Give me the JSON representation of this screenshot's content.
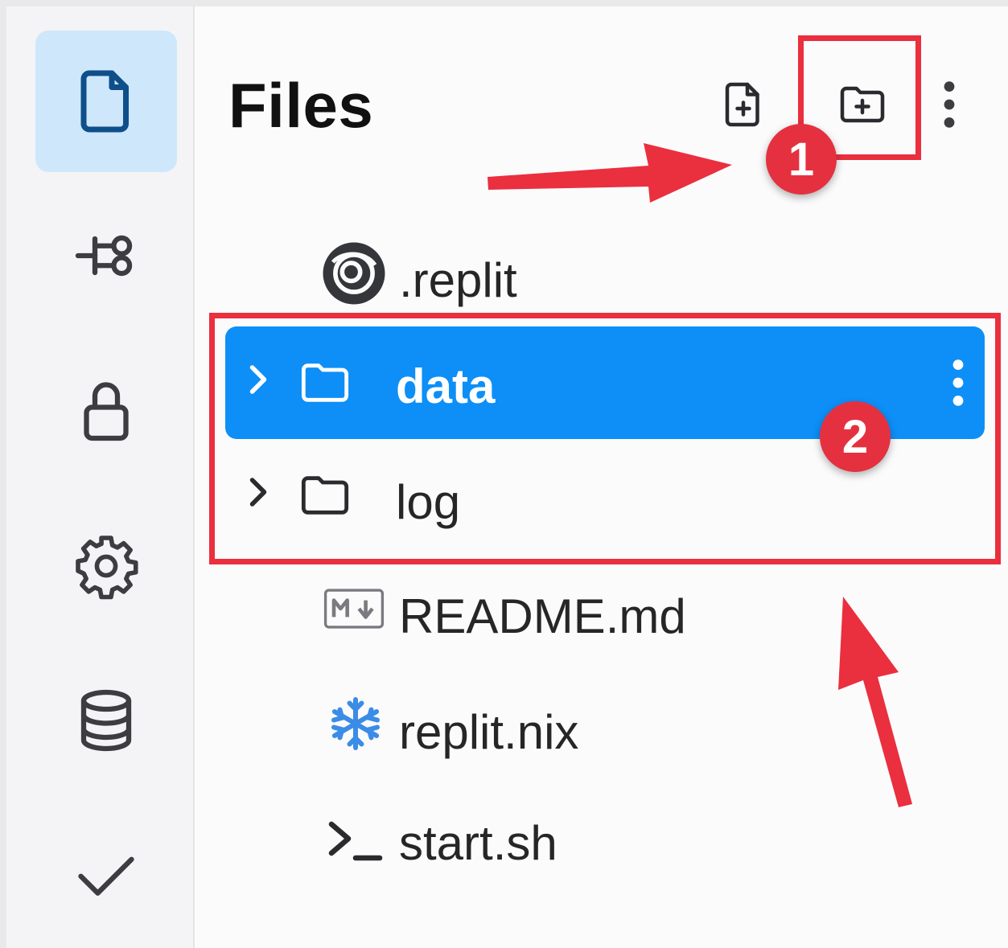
{
  "panel": {
    "title": "Files"
  },
  "files": [
    {
      "name": ".replit",
      "icon": "replit-logo-icon"
    },
    {
      "name": "data",
      "icon": "folder-icon",
      "kind": "folder",
      "selected": true
    },
    {
      "name": "log",
      "icon": "folder-icon",
      "kind": "folder"
    },
    {
      "name": "README.md",
      "icon": "markdown-icon"
    },
    {
      "name": "replit.nix",
      "icon": "nix-snowflake-icon"
    },
    {
      "name": "start.sh",
      "icon": "terminal-icon"
    }
  ],
  "annotations": {
    "badge_1": "1",
    "badge_2": "2"
  },
  "colors": {
    "accent": "#0d8ff7",
    "highlight": "#ea2f3e",
    "active_rail": "#cfe7fb"
  }
}
